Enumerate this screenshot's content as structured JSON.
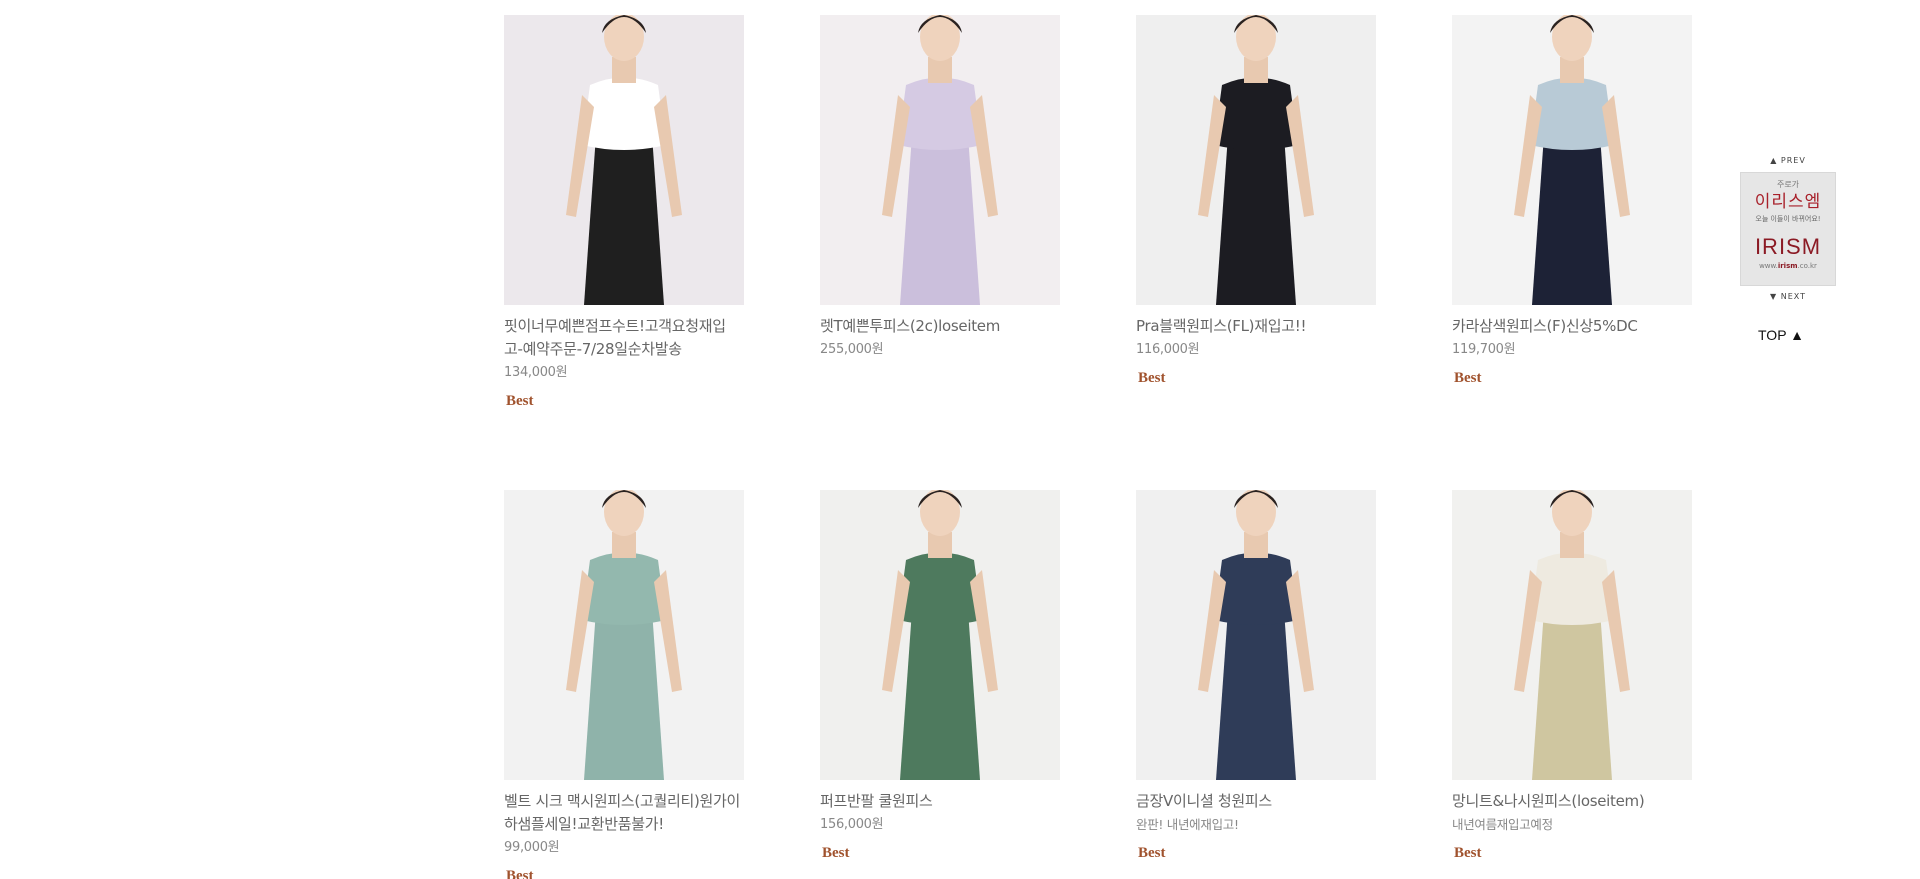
{
  "products": [
    {
      "name": "핏이너무예쁜점프수트!고객요청재입고-예약주문-7/28일순차발송",
      "price": "134,000원",
      "note": "",
      "badge": "Best",
      "bg": "#ece8ec",
      "garment": "#1f1f1f",
      "top": "#ffffff"
    },
    {
      "name": "렛T예쁜투피스(2c)loseitem",
      "price": "255,000원",
      "note": "",
      "badge": "",
      "bg": "#f2eef0",
      "garment": "#cbbfdc",
      "top": "#d5cae3"
    },
    {
      "name": "Pra블랙원피스(FL)재입고!!",
      "price": "116,000원",
      "note": "",
      "badge": "Best",
      "bg": "#efefef",
      "garment": "#1c1c22",
      "top": "#1c1c22"
    },
    {
      "name": "카라삼색원피스(F)신상5%DC",
      "price": "119,700원",
      "note": "",
      "badge": "Best",
      "bg": "#f3f3f3",
      "garment": "#1d2236",
      "top": "#b8cad6"
    },
    {
      "name": "벨트 시크 맥시원피스(고퀄리티)원가이하샘플세일!교환반품불가!",
      "price": "99,000원",
      "note": "",
      "badge": "Best",
      "bg": "#f2f2f2",
      "garment": "#8fb3aa",
      "top": "#93b8ae"
    },
    {
      "name": "퍼프반팔 쿨원피스",
      "price": "156,000원",
      "note": "",
      "badge": "Best",
      "bg": "#f0f0ee",
      "garment": "#4e7a5e",
      "top": "#4e7a5e"
    },
    {
      "name": "금장V이니셜 청원피스",
      "price": "",
      "note": "완판! 내년에재입고!",
      "badge": "Best",
      "bg": "#f0f0f0",
      "garment": "#2f3c58",
      "top": "#2f3c58"
    },
    {
      "name": "망니트&나시원피스(loseitem)",
      "price": "",
      "note": "내년여름재입고예정",
      "badge": "Best",
      "bg": "#f1f1ef",
      "garment": "#cfc6a0",
      "top": "#eeeae0"
    }
  ],
  "side": {
    "prev": "▲ PREV",
    "next": "▼ NEXT",
    "banner_small": "주로가",
    "banner_title": "이리스엠",
    "banner_sub": "오늘 이들이 바뀌어요!",
    "banner_logo": "IRISM",
    "banner_url_prefix": "www.",
    "banner_url_brand": "irism",
    "banner_url_suffix": ".co.kr",
    "top": "TOP ▲"
  }
}
